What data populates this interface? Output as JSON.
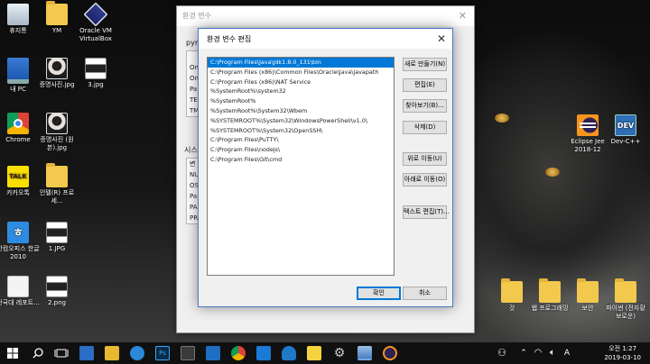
{
  "desktop": {
    "left_icons": [
      {
        "label": "휴지통",
        "icon": "recycle-bin-icon"
      },
      {
        "label": "YM",
        "icon": "folder-icon"
      },
      {
        "label": "Oracle VM VirtualBox",
        "icon": "virtualbox-icon"
      },
      {
        "label": "내 PC",
        "icon": "pc-icon"
      },
      {
        "label": "증명사진.jpg",
        "icon": "photo-icon"
      },
      {
        "label": "3.jpg",
        "icon": "image-file-icon"
      },
      {
        "label": "Chrome",
        "icon": "chrome-icon"
      },
      {
        "label": "증명사진 (원본).jpg",
        "icon": "photo-icon"
      },
      {
        "label": "카카오톡",
        "icon": "kakaotalk-icon"
      },
      {
        "label": "인텔(R) 프로세...",
        "icon": "folder-icon"
      },
      {
        "label": "한컴오피스 한글 2010",
        "icon": "hancom-icon"
      },
      {
        "label": "1.JPG",
        "icon": "image-file-icon"
      },
      {
        "label": "단국대 레포트...",
        "icon": "document-icon"
      },
      {
        "label": "2.png",
        "icon": "image-file-icon"
      }
    ],
    "right_icons": [
      {
        "label": "Eclipse Jee 2018-12",
        "icon": "eclipse-icon"
      },
      {
        "label": "Dev-C++",
        "icon": "devcpp-icon"
      },
      {
        "label": "것",
        "icon": "folder-icon"
      },
      {
        "label": "웹 프로그래밍",
        "icon": "folder-icon"
      },
      {
        "label": "보안",
        "icon": "folder-icon"
      },
      {
        "label": "파이썬 (전자황보로운)",
        "icon": "folder-icon"
      }
    ]
  },
  "env_window": {
    "title": "환경 변수",
    "user_section_prefix": "pym",
    "user_rows": [
      "On",
      "On",
      "Pa",
      "TE",
      "TM"
    ],
    "system_section_prefix": "시스",
    "system_rows": [
      "변",
      "NU",
      "OS",
      "Pa",
      "PA",
      "PR"
    ]
  },
  "edit_dialog": {
    "title": "환경 변수 편집",
    "paths": [
      "C:\\Program Files\\Java\\jdk1.8.0_131\\bin",
      "C:\\Program Files (x86)\\Common Files\\Oracle\\Java\\javapath",
      "C:\\Program Files (x86)\\NAT Service",
      "%SystemRoot%\\system32",
      "%SystemRoot%",
      "%SystemRoot%\\System32\\Wbem",
      "%SYSTEMROOT%\\System32\\WindowsPowerShell\\v1.0\\",
      "%SYSTEMROOT%\\System32\\OpenSSH\\",
      "C:\\Program Files\\PuTTY\\",
      "C:\\Program Files\\nodejs\\",
      "C:\\Program Files\\Git\\cmd"
    ],
    "selected_index": 0,
    "buttons": {
      "new": "새로 만들기(N)",
      "edit": "편집(E)",
      "browse": "찾아보기(B)...",
      "delete": "삭제(D)",
      "move_up": "위로 이동(U)",
      "move_down": "아래로 이동(O)",
      "edit_text": "텍스트 편집(T)...",
      "ok": "확인",
      "cancel": "취소"
    }
  },
  "taskbar": {
    "time": "오전 1:27",
    "date": "2019-03-10"
  }
}
